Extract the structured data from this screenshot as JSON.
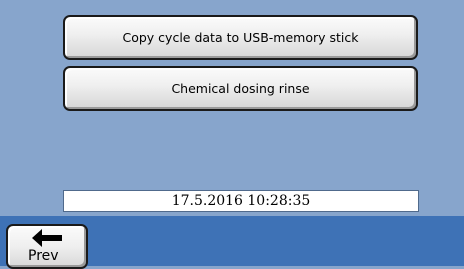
{
  "menu": {
    "copy_label": "Copy cycle data to USB-memory stick",
    "dosing_label": "Chemical dosing rinse"
  },
  "status": {
    "datetime": "17.5.2016 10:28:35"
  },
  "nav": {
    "prev_label": "Prev",
    "prev_icon": "arrow-left-icon"
  },
  "colors": {
    "background": "#87a5cc",
    "bottom_bar": "#3e72b6",
    "button_face": "#efefef"
  }
}
